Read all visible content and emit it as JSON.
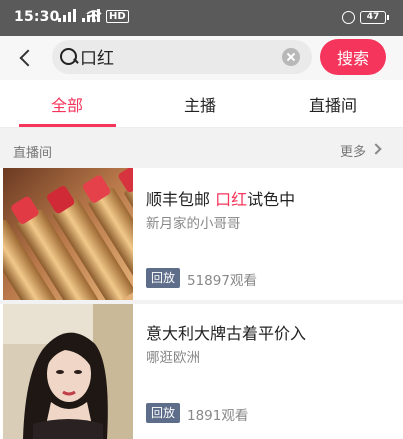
{
  "status_bar": {
    "time": "15:30",
    "network": "HD",
    "battery": "47"
  },
  "search": {
    "query": "口红",
    "button_label": "搜索"
  },
  "tabs": [
    {
      "label": "全部",
      "active": true
    },
    {
      "label": "主播",
      "active": false
    },
    {
      "label": "直播间",
      "active": false
    }
  ],
  "section": {
    "title": "直播间",
    "more_label": "更多"
  },
  "results": [
    {
      "title_before": "顺丰包邮 ",
      "title_highlight": "口红",
      "title_after": "试色中",
      "host": "新月家的小哥哥",
      "badge": "回放",
      "views": "51897观看"
    },
    {
      "title_before": "意大利大牌古着平价入",
      "title_highlight": "",
      "title_after": "",
      "host": "哪逛欧洲",
      "badge": "回放",
      "views": "1891观看"
    }
  ],
  "colors": {
    "accent": "#f5355c",
    "badge": "#5d6d8a",
    "status_bar": "#5a5a5a"
  }
}
